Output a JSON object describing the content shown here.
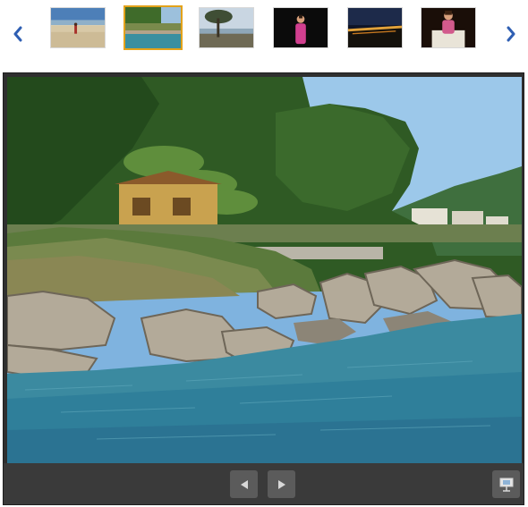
{
  "thumbnails": [
    {
      "name": "beach-walk",
      "selected": false
    },
    {
      "name": "rocky-shore",
      "selected": true
    },
    {
      "name": "lakeside-tree",
      "selected": false
    },
    {
      "name": "night-portrait",
      "selected": false
    },
    {
      "name": "city-lights",
      "selected": false
    },
    {
      "name": "evening-seat",
      "selected": false
    }
  ],
  "icons": {
    "prev": "chevron-left-icon",
    "next": "chevron-right-icon",
    "back": "triangle-left-icon",
    "forward": "triangle-right-icon",
    "slideshow": "projector-screen-icon"
  },
  "colors": {
    "accent_arrow": "#2f5fb3",
    "selected_border": "#e3a21a",
    "viewer_bg": "#2f2f2f",
    "control_bar": "#3a3a3a",
    "button": "#5b5b5b"
  }
}
